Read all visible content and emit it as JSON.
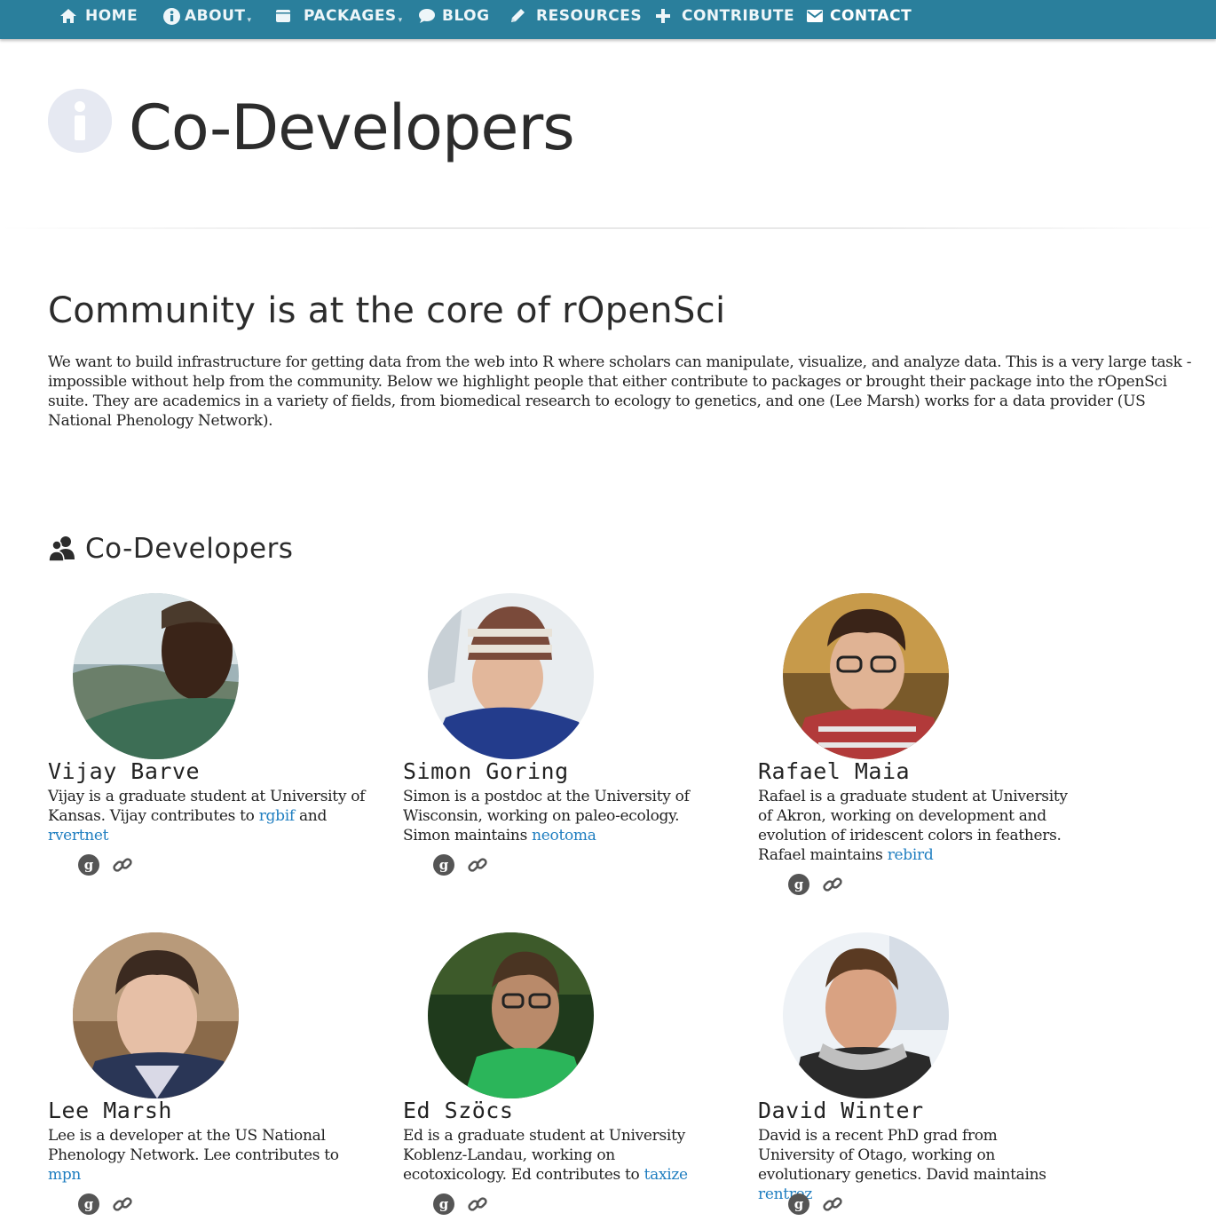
{
  "nav": {
    "items": [
      {
        "label": "HOME",
        "icon": "home-icon"
      },
      {
        "label": "ABOUT",
        "icon": "info-icon"
      },
      {
        "label": "PACKAGES",
        "icon": "book-icon"
      },
      {
        "label": "BLOG",
        "icon": "chat-bubble-icon"
      },
      {
        "label": "RESOURCES",
        "icon": "pencil-icon"
      },
      {
        "label": "CONTRIBUTE",
        "icon": "plus-icon"
      },
      {
        "label": "CONTACT",
        "icon": "envelope-icon"
      }
    ],
    "active": "CONTACT",
    "color": "#2a7f9c"
  },
  "header": {
    "title": "Co-Developers",
    "icon": "info-circle-icon"
  },
  "section": {
    "title": "Community is at the core of rOpenSci",
    "intro": "We want to build infrastructure for getting data from the web into R where scholars can manipulate, visualize, and analyze data. This is a very large task - impossible without help from the community. Below we highlight people that either contribute to packages or brought their package into the rOpenSci suite. They are academics in a variety of fields, from biomedical research to ecology to genetics, and one (Lee Marsh) works for a data provider (US National Phenology Network)."
  },
  "codevs": {
    "heading": "Co-Developers",
    "icon": "people-icon",
    "people": [
      {
        "name": "Vijay Barve",
        "bio_pre": "Vijay is a graduate student at University of Kansas. Vijay contributes to ",
        "pkg1": "rgbif",
        "mid": " and ",
        "pkg2": "rvertnet",
        "post": ""
      },
      {
        "name": "Simon Goring",
        "bio_pre": "Simon is a postdoc at the University of Wisconsin, working on paleo-ecology. Simon maintains ",
        "pkg1": "neotoma",
        "post": ""
      },
      {
        "name": "Rafael Maia",
        "bio_pre": "Rafael is a graduate student at University of Akron, working on development and evolution of iridescent colors in feathers. Rafael maintains ",
        "pkg1": "rebird",
        "post": ""
      },
      {
        "name": "Lee Marsh",
        "bio_pre": "Lee is a developer at the US National Phenology Network. Lee contributes to ",
        "pkg1": "mpn",
        "post": ""
      },
      {
        "name": "Ed Szöcs",
        "bio_pre": "Ed is a graduate student at University Koblenz-Landau, working on ecotoxicology. Ed contributes to ",
        "pkg1": "taxize",
        "post": ""
      },
      {
        "name": "David Winter",
        "bio_pre": "David is a recent PhD grad from University of Otago, working on evolutionary genetics. David maintains ",
        "pkg1": "rentrez",
        "post": ""
      }
    ],
    "link_icons": [
      "google-icon",
      "link-icon"
    ],
    "link_color": "#1f7ec0"
  }
}
